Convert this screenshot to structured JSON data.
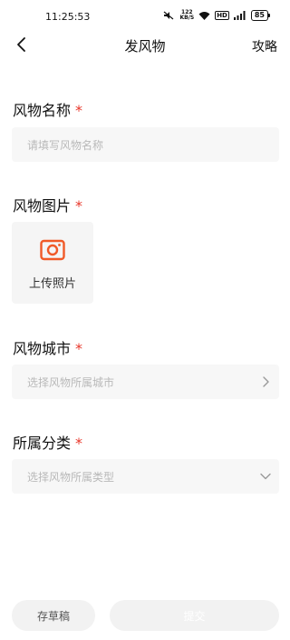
{
  "status_bar": {
    "time": "11:25:53",
    "net_speed_value": "122",
    "net_speed_unit": "KB/S",
    "signal_text": "HD",
    "battery": "85"
  },
  "nav": {
    "title": "发风物",
    "right_label": "攻略",
    "back_icon": "chevron-left-icon"
  },
  "form": {
    "name": {
      "label": "风物名称",
      "required_mark": "*",
      "placeholder": "请填写风物名称"
    },
    "image": {
      "label": "风物图片",
      "required_mark": "*",
      "upload_label": "上传照片",
      "upload_icon": "camera-icon",
      "accent_color": "#f05a28"
    },
    "city": {
      "label": "风物城市",
      "required_mark": "*",
      "placeholder": "选择风物所属城市",
      "icon": "chevron-right-icon"
    },
    "category": {
      "label": "所属分类",
      "required_mark": "*",
      "placeholder": "选择风物所属类型",
      "icon": "chevron-down-icon"
    }
  },
  "actions": {
    "draft_label": "存草稿",
    "submit_label": "提交"
  },
  "colors": {
    "required": "#e8362a",
    "accent": "#f05a28",
    "field_bg": "#f7f7f7"
  }
}
